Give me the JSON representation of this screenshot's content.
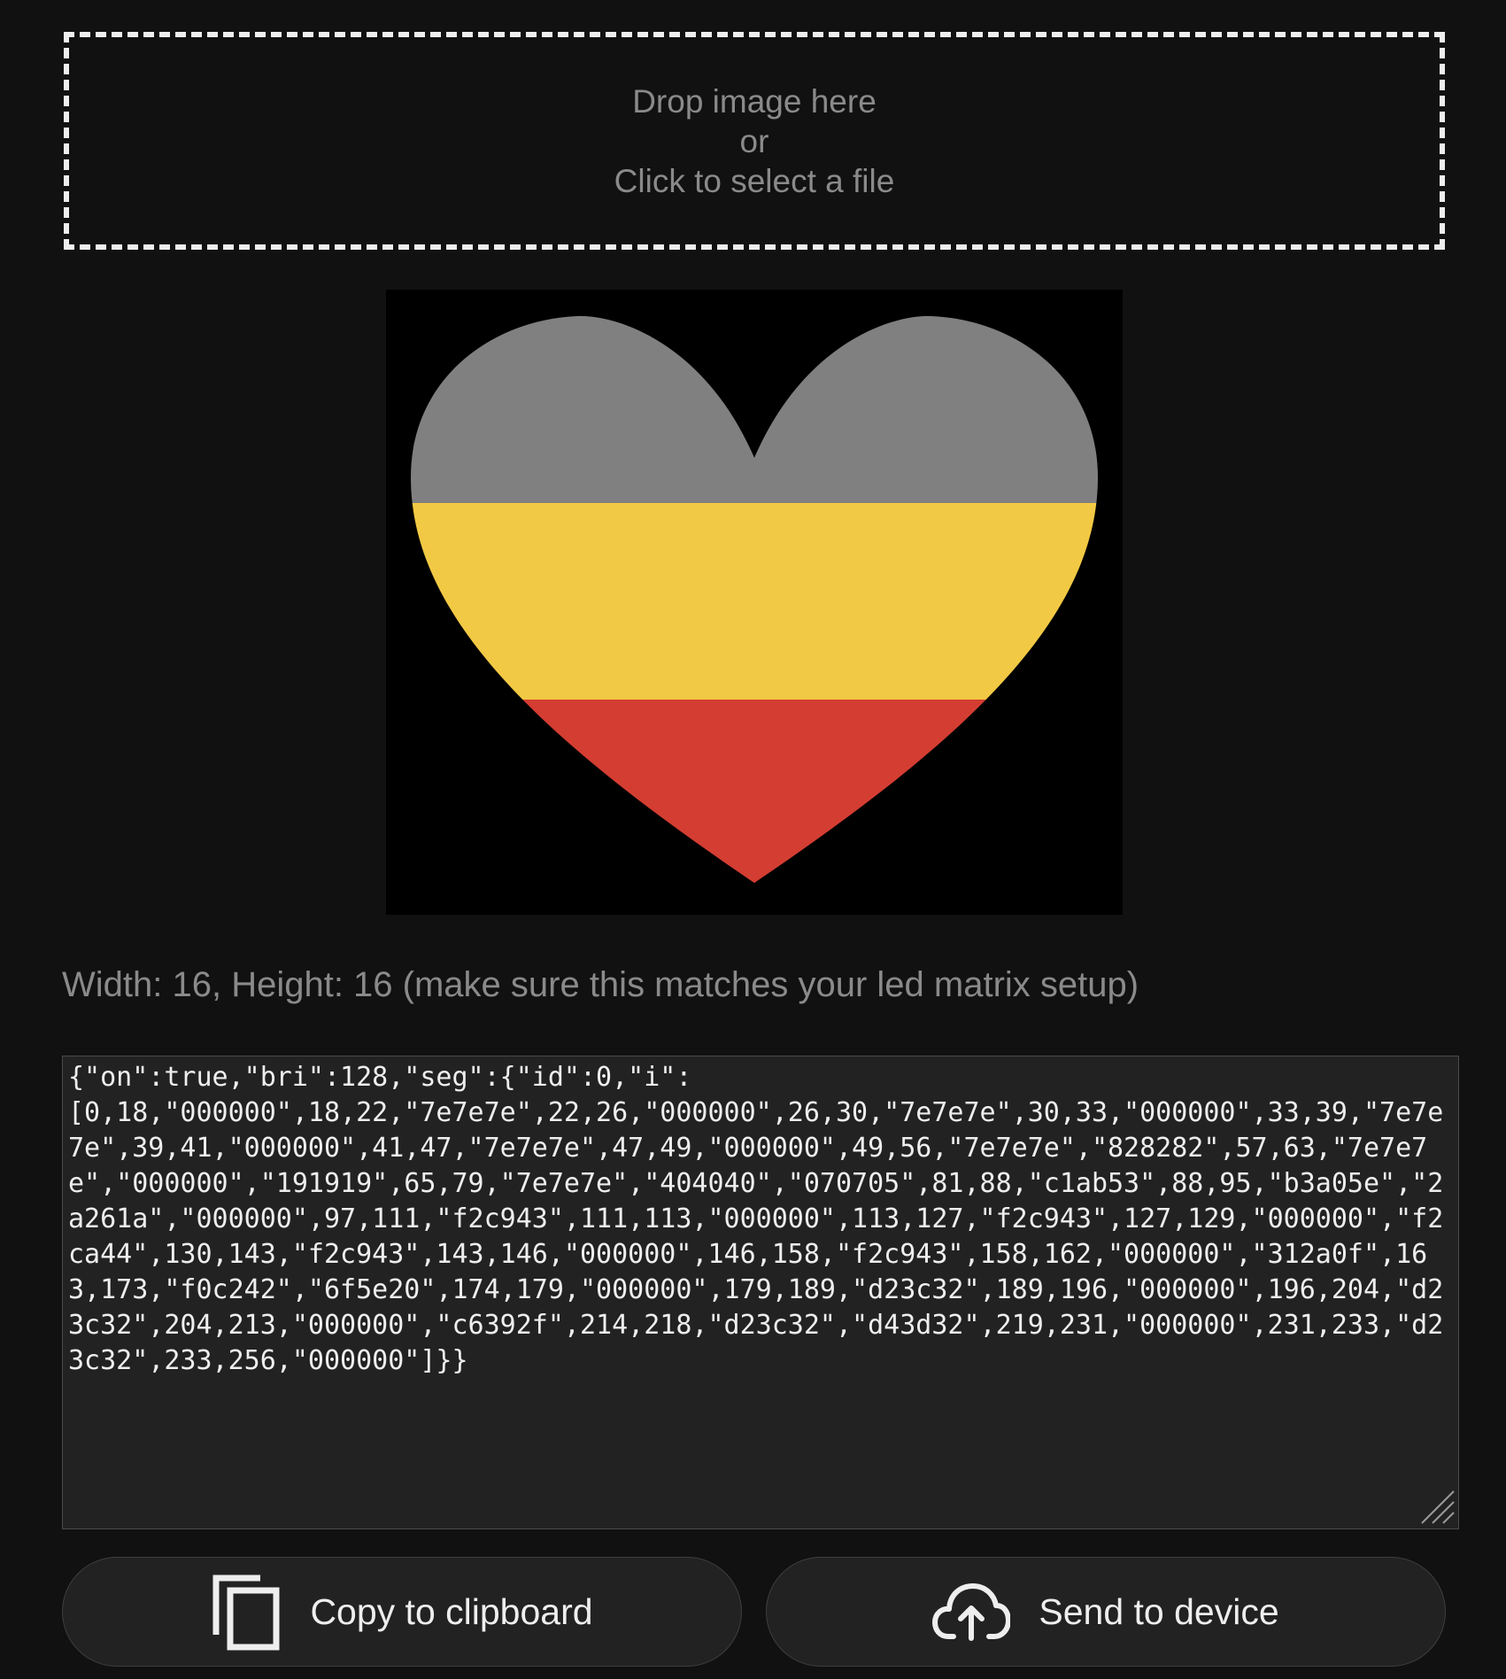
{
  "dropzone": {
    "line1": "Drop image here",
    "line2": "or",
    "line3": "Click to select a file"
  },
  "preview": {
    "background": "#000000",
    "stripe_colors": [
      "#808080",
      "#f2c944",
      "#d43d32"
    ]
  },
  "info": {
    "dimensions_text": "Width: 16, Height: 16 (make sure this matches your led matrix setup)"
  },
  "output": {
    "json_text": "{\"on\":true,\"bri\":128,\"seg\":{\"id\":0,\"i\":\n[0,18,\"000000\",18,22,\"7e7e7e\",22,26,\"000000\",26,30,\"7e7e7e\",30,33,\"000000\",33,39,\"7e7e7e\",39,41,\"000000\",41,47,\"7e7e7e\",47,49,\"000000\",49,56,\"7e7e7e\",\"828282\",57,63,\"7e7e7e\",\"000000\",\"191919\",65,79,\"7e7e7e\",\"404040\",\"070705\",81,88,\"c1ab53\",88,95,\"b3a05e\",\"2a261a\",\"000000\",97,111,\"f2c943\",111,113,\"000000\",113,127,\"f2c943\",127,129,\"000000\",\"f2ca44\",130,143,\"f2c943\",143,146,\"000000\",146,158,\"f2c943\",158,162,\"000000\",\"312a0f\",163,173,\"f0c242\",\"6f5e20\",174,179,\"000000\",179,189,\"d23c32\",189,196,\"000000\",196,204,\"d23c32\",204,213,\"000000\",\"c6392f\",214,218,\"d23c32\",\"d43d32\",219,231,\"000000\",231,233,\"d23c32\",233,256,\"000000\"]}}"
  },
  "buttons": {
    "copy_label": "Copy to clipboard",
    "copy_icon": "copy-icon",
    "send_label": "Send to device",
    "send_icon": "cloud-upload-icon"
  }
}
